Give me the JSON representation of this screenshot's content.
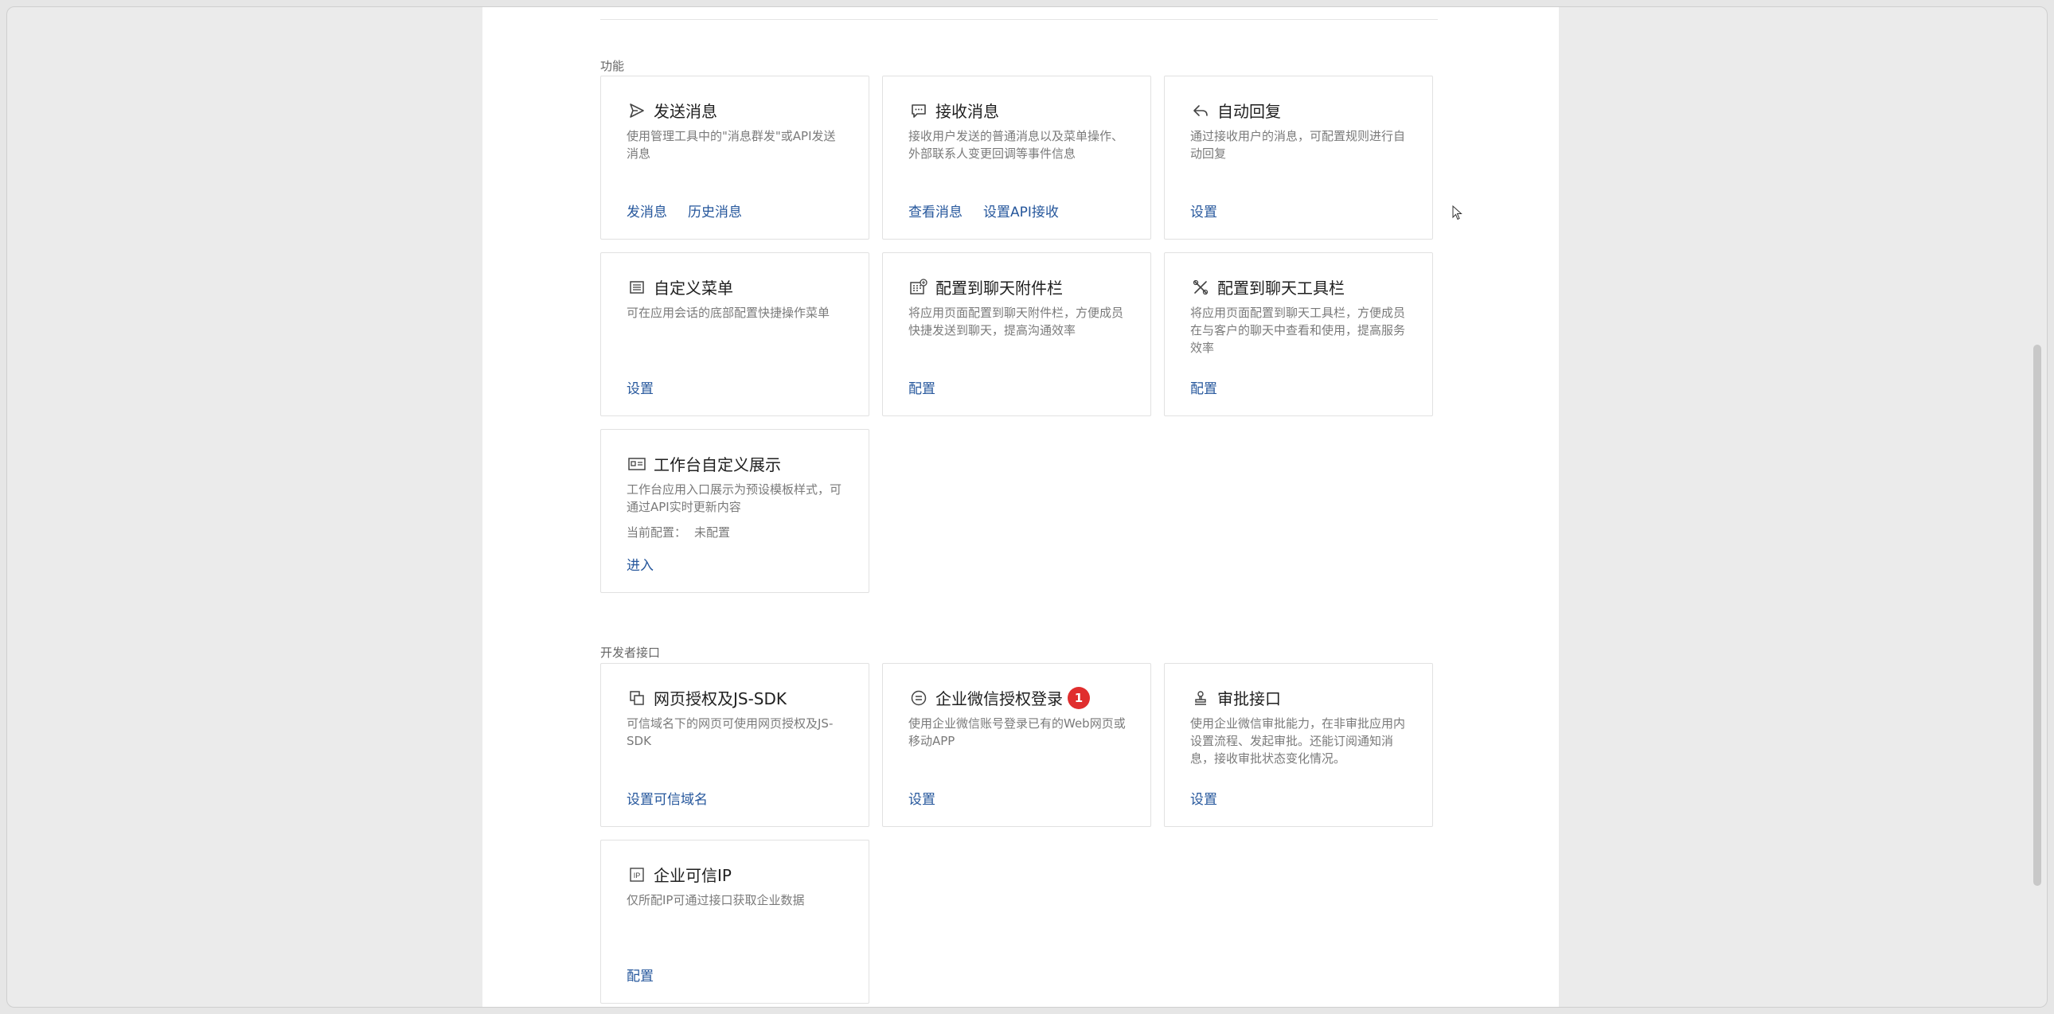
{
  "sections": {
    "features_title": "功能",
    "developer_title": "开发者接口"
  },
  "cards": {
    "send_message": {
      "title": "发送消息",
      "desc": "使用管理工具中的\"消息群发\"或API发送消息",
      "link1": "发消息",
      "link2": "历史消息"
    },
    "receive_message": {
      "title": "接收消息",
      "desc": "接收用户发送的普通消息以及菜单操作、外部联系人变更回调等事件信息",
      "link1": "查看消息",
      "link2": "设置API接收"
    },
    "auto_reply": {
      "title": "自动回复",
      "desc": "通过接收用户的消息，可配置规则进行自动回复",
      "link1": "设置"
    },
    "custom_menu": {
      "title": "自定义菜单",
      "desc": "可在应用会话的底部配置快捷操作菜单",
      "link1": "设置"
    },
    "chat_attachment": {
      "title": "配置到聊天附件栏",
      "desc": "将应用页面配置到聊天附件栏，方便成员快捷发送到聊天，提高沟通效率",
      "link1": "配置"
    },
    "chat_toolbar": {
      "title": "配置到聊天工具栏",
      "desc": "将应用页面配置到聊天工具栏，方便成员在与客户的聊天中查看和使用，提高服务效率",
      "link1": "配置"
    },
    "workbench_display": {
      "title": "工作台自定义展示",
      "desc": "工作台应用入口展示为预设模板样式，可通过API实时更新内容",
      "current_label": "当前配置：",
      "current_value": "未配置",
      "link1": "进入"
    },
    "web_auth": {
      "title": "网页授权及JS-SDK",
      "desc": "可信域名下的网页可使用网页授权及JS-SDK",
      "link1": "设置可信域名"
    },
    "wecom_login": {
      "title": "企业微信授权登录",
      "badge": "1",
      "desc": "使用企业微信账号登录已有的Web网页或移动APP",
      "link1": "设置"
    },
    "approval_api": {
      "title": "审批接口",
      "desc": "使用企业微信审批能力，在非审批应用内设置流程、发起审批。还能订阅通知消息，接收审批状态变化情况。",
      "link1": "设置"
    },
    "trusted_ip": {
      "title": "企业可信IP",
      "desc": "仅所配IP可通过接口获取企业数据",
      "link1": "配置"
    }
  },
  "colors": {
    "link": "#26579c",
    "badge": "#e02e2e"
  }
}
